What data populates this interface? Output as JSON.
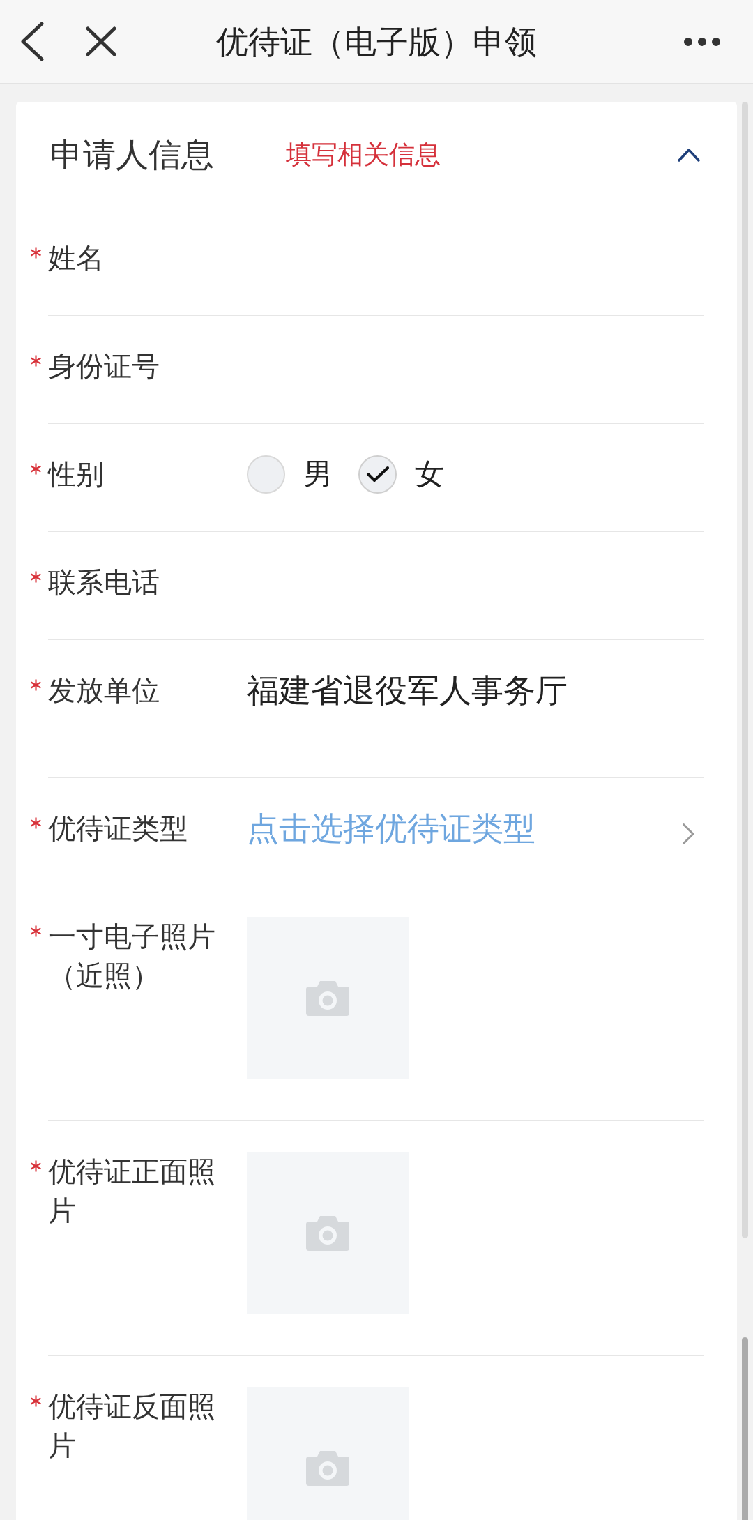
{
  "header": {
    "title": "优待证（电子版）申领"
  },
  "section": {
    "title": "申请人信息",
    "hint": "填写相关信息",
    "expanded": true
  },
  "fields": [
    {
      "kind": "input",
      "label": "姓名",
      "required": true
    },
    {
      "kind": "input",
      "label": "身份证号",
      "required": true
    },
    {
      "kind": "radio",
      "label": "性别",
      "required": true,
      "options": [
        {
          "label": "男",
          "selected": false
        },
        {
          "label": "女",
          "selected": true
        }
      ]
    },
    {
      "kind": "input",
      "label": "联系电话",
      "required": true
    },
    {
      "kind": "static",
      "label": "发放单位",
      "required": true,
      "value": "福建省退役军人事务厅"
    },
    {
      "kind": "select",
      "label": "优待证类型",
      "required": true,
      "placeholder": "点击选择优待证类型"
    },
    {
      "kind": "photo",
      "label": "一寸电子照片（近照）",
      "required": true
    },
    {
      "kind": "photo",
      "label": "优待证正面照片",
      "required": true
    },
    {
      "kind": "photo",
      "label": "优待证反面照片",
      "required": true
    }
  ]
}
